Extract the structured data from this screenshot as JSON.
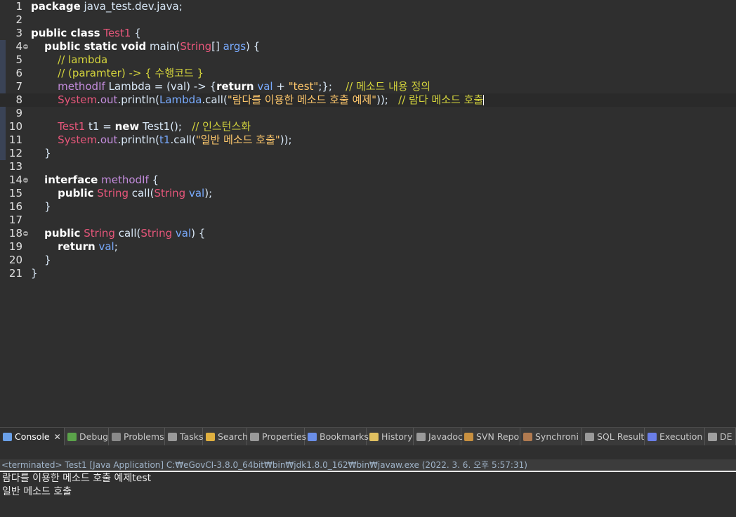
{
  "editor": {
    "lines": [
      {
        "n": "1",
        "segs": [
          {
            "t": "package",
            "c": "kw"
          },
          {
            "t": " java_test.dev.java;",
            "c": ""
          }
        ]
      },
      {
        "n": "2",
        "segs": []
      },
      {
        "n": "3",
        "segs": [
          {
            "t": "public class",
            "c": "kw"
          },
          {
            "t": " ",
            "c": ""
          },
          {
            "t": "Test1",
            "c": "ty"
          },
          {
            "t": " {",
            "c": ""
          }
        ]
      },
      {
        "n": "4",
        "fold": true,
        "segs": [
          {
            "t": "    ",
            "c": ""
          },
          {
            "t": "public static void",
            "c": "kw"
          },
          {
            "t": " main(",
            "c": ""
          },
          {
            "t": "String",
            "c": "ty"
          },
          {
            "t": "[] ",
            "c": ""
          },
          {
            "t": "args",
            "c": "var"
          },
          {
            "t": ") {",
            "c": ""
          }
        ]
      },
      {
        "n": "5",
        "segs": [
          {
            "t": "        ",
            "c": ""
          },
          {
            "t": "// lambda",
            "c": "cm"
          }
        ]
      },
      {
        "n": "6",
        "segs": [
          {
            "t": "        ",
            "c": ""
          },
          {
            "t": "// (paramter) -> { 수행코드 }",
            "c": "cm"
          }
        ]
      },
      {
        "n": "7",
        "segs": [
          {
            "t": "        ",
            "c": ""
          },
          {
            "t": "methodIf",
            "c": "field"
          },
          {
            "t": " Lambda = (val) -> {",
            "c": ""
          },
          {
            "t": "return",
            "c": "kw"
          },
          {
            "t": " ",
            "c": ""
          },
          {
            "t": "val",
            "c": "var"
          },
          {
            "t": " + ",
            "c": ""
          },
          {
            "t": "\"test\"",
            "c": "str"
          },
          {
            "t": ";};    ",
            "c": ""
          },
          {
            "t": "// 메소드 내용 정의",
            "c": "cm"
          }
        ]
      },
      {
        "n": "8",
        "current": true,
        "segs": [
          {
            "t": "        ",
            "c": ""
          },
          {
            "t": "System",
            "c": "ty"
          },
          {
            "t": ".",
            "c": ""
          },
          {
            "t": "out",
            "c": "field"
          },
          {
            "t": ".println(",
            "c": ""
          },
          {
            "t": "Lambda",
            "c": "var"
          },
          {
            "t": ".call(",
            "c": ""
          },
          {
            "t": "\"람다를 이용한 메소드 호출 예제\"",
            "c": "str"
          },
          {
            "t": "));   ",
            "c": ""
          },
          {
            "t": "// 람다 메소드 호출",
            "c": "cm"
          }
        ]
      },
      {
        "n": "9",
        "segs": []
      },
      {
        "n": "10",
        "segs": [
          {
            "t": "        ",
            "c": ""
          },
          {
            "t": "Test1",
            "c": "ty"
          },
          {
            "t": " t1 = ",
            "c": ""
          },
          {
            "t": "new",
            "c": "kw"
          },
          {
            "t": " Test1();   ",
            "c": ""
          },
          {
            "t": "// 인스턴스화",
            "c": "cm"
          }
        ]
      },
      {
        "n": "11",
        "segs": [
          {
            "t": "        ",
            "c": ""
          },
          {
            "t": "System",
            "c": "ty"
          },
          {
            "t": ".",
            "c": ""
          },
          {
            "t": "out",
            "c": "field"
          },
          {
            "t": ".println(",
            "c": ""
          },
          {
            "t": "t1",
            "c": "var"
          },
          {
            "t": ".call(",
            "c": ""
          },
          {
            "t": "\"일반 메소드 호출\"",
            "c": "str"
          },
          {
            "t": "));",
            "c": ""
          }
        ]
      },
      {
        "n": "12",
        "segs": [
          {
            "t": "    }",
            "c": ""
          }
        ]
      },
      {
        "n": "13",
        "segs": []
      },
      {
        "n": "14",
        "fold": true,
        "segs": [
          {
            "t": "    ",
            "c": ""
          },
          {
            "t": "interface",
            "c": "kw"
          },
          {
            "t": " ",
            "c": ""
          },
          {
            "t": "methodIf",
            "c": "field"
          },
          {
            "t": " {",
            "c": ""
          }
        ]
      },
      {
        "n": "15",
        "segs": [
          {
            "t": "        ",
            "c": ""
          },
          {
            "t": "public",
            "c": "kw"
          },
          {
            "t": " ",
            "c": ""
          },
          {
            "t": "String",
            "c": "ty"
          },
          {
            "t": " call(",
            "c": ""
          },
          {
            "t": "String",
            "c": "ty"
          },
          {
            "t": " ",
            "c": ""
          },
          {
            "t": "val",
            "c": "var"
          },
          {
            "t": ");",
            "c": ""
          }
        ]
      },
      {
        "n": "16",
        "segs": [
          {
            "t": "    }",
            "c": ""
          }
        ]
      },
      {
        "n": "17",
        "segs": []
      },
      {
        "n": "18",
        "fold": true,
        "segs": [
          {
            "t": "    ",
            "c": ""
          },
          {
            "t": "public",
            "c": "kw"
          },
          {
            "t": " ",
            "c": ""
          },
          {
            "t": "String",
            "c": "ty"
          },
          {
            "t": " call(",
            "c": ""
          },
          {
            "t": "String",
            "c": "ty"
          },
          {
            "t": " ",
            "c": ""
          },
          {
            "t": "val",
            "c": "var"
          },
          {
            "t": ") {",
            "c": ""
          }
        ]
      },
      {
        "n": "19",
        "segs": [
          {
            "t": "        ",
            "c": ""
          },
          {
            "t": "return",
            "c": "kw"
          },
          {
            "t": " ",
            "c": ""
          },
          {
            "t": "val",
            "c": "var"
          },
          {
            "t": ";",
            "c": ""
          }
        ]
      },
      {
        "n": "20",
        "segs": [
          {
            "t": "    }",
            "c": ""
          }
        ]
      },
      {
        "n": "21",
        "segs": [
          {
            "t": "}",
            "c": ""
          }
        ]
      }
    ]
  },
  "tabs": [
    {
      "label": "Console",
      "icon": "console-icon",
      "color": "#6aa0e8",
      "active": true,
      "close": "✕"
    },
    {
      "label": "Debug",
      "icon": "bug-icon",
      "color": "#5ba34a"
    },
    {
      "label": "Problems",
      "icon": "problems-icon",
      "color": "#8a8a8a"
    },
    {
      "label": "Tasks",
      "icon": "tasks-icon",
      "color": "#9a9a9a"
    },
    {
      "label": "Search",
      "icon": "search-icon",
      "color": "#e0b040"
    },
    {
      "label": "Properties",
      "icon": "properties-icon",
      "color": "#9a9a9a"
    },
    {
      "label": "Bookmarks",
      "icon": "bookmark-icon",
      "color": "#6a8ee8"
    },
    {
      "label": "History",
      "icon": "history-icon",
      "color": "#e0c060"
    },
    {
      "label": "Javadoc",
      "icon": "javadoc-icon",
      "color": "#9a9a9a"
    },
    {
      "label": "SVN Repo",
      "icon": "svn-icon",
      "color": "#c89040"
    },
    {
      "label": "Synchroni",
      "icon": "synchronize-icon",
      "color": "#b07a50"
    },
    {
      "label": "SQL Result",
      "icon": "sql-result-icon",
      "color": "#9a9a9a"
    },
    {
      "label": "Execution",
      "icon": "execution-icon",
      "color": "#6a7ee8"
    },
    {
      "label": "DE",
      "icon": "de-icon",
      "color": "#a0a0a0"
    }
  ],
  "console": {
    "status": "<terminated> Test1 [Java Application] C:₩eGovCI-3.8.0_64bit₩bin₩jdk1.8.0_162₩bin₩javaw.exe (2022. 3. 6. 오후 5:57:31)",
    "output": [
      "람다를 이용한 메소드 호출 예제test",
      "일반 메소드 호출"
    ]
  }
}
